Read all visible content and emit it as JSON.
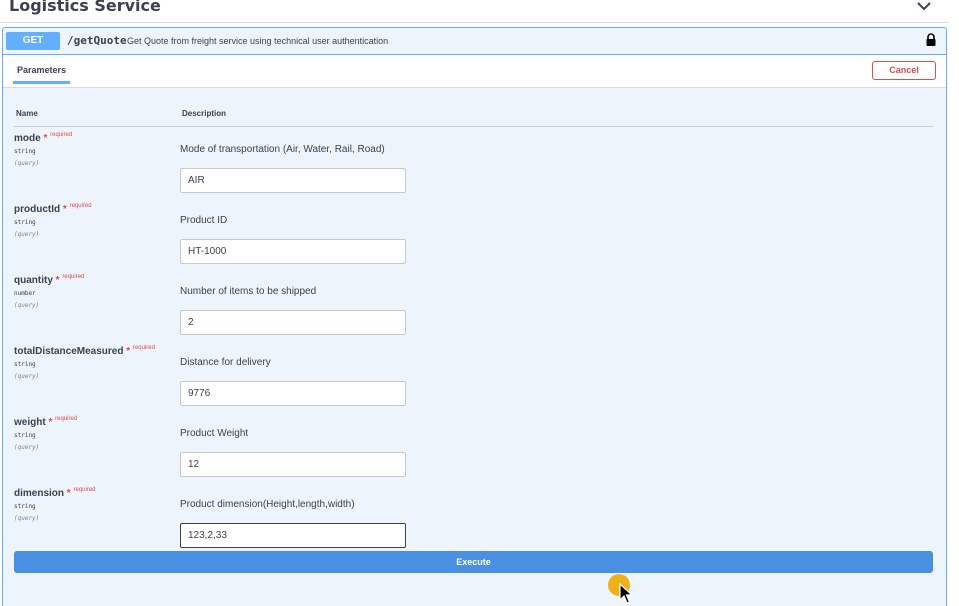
{
  "section": {
    "title": "Logistics Service"
  },
  "operation": {
    "method": "GET",
    "path": "/getQuote",
    "description": "Get Quote from freight service using technical user authentication"
  },
  "tabs": {
    "parameters": "Parameters",
    "cancel": "Cancel"
  },
  "columns": {
    "name": "Name",
    "description": "Description"
  },
  "params": [
    {
      "name": "mode",
      "required": "required",
      "type": "string",
      "in": "(query)",
      "description": "Mode of transportation (Air, Water, Rail, Road)",
      "value": "AIR"
    },
    {
      "name": "productId",
      "required": "required",
      "type": "string",
      "in": "(query)",
      "description": "Product ID",
      "value": "HT-1000"
    },
    {
      "name": "quantity",
      "required": "required",
      "type": "number",
      "in": "(query)",
      "description": "Number of items to be shipped",
      "value": "2"
    },
    {
      "name": "totalDistanceMeasured",
      "required": "required",
      "type": "string",
      "in": "(query)",
      "description": "Distance for delivery",
      "value": "9776"
    },
    {
      "name": "weight",
      "required": "required",
      "type": "string",
      "in": "(query)",
      "description": "Product Weight",
      "value": "12"
    },
    {
      "name": "dimension",
      "required": "required",
      "type": "string",
      "in": "(query)",
      "description": "Product dimension(Height,length,width)",
      "value": "123,2,33"
    }
  ],
  "actions": {
    "execute": "Execute"
  },
  "colors": {
    "get_blue": "#61affe",
    "execute_blue": "#4990e2",
    "required_red": "#e04b4b",
    "cursor_highlight": "#f0a800"
  },
  "icons": {
    "collapse": "chevron-down-icon",
    "lock": "lock-icon",
    "pointer": "mouse-pointer-icon"
  }
}
